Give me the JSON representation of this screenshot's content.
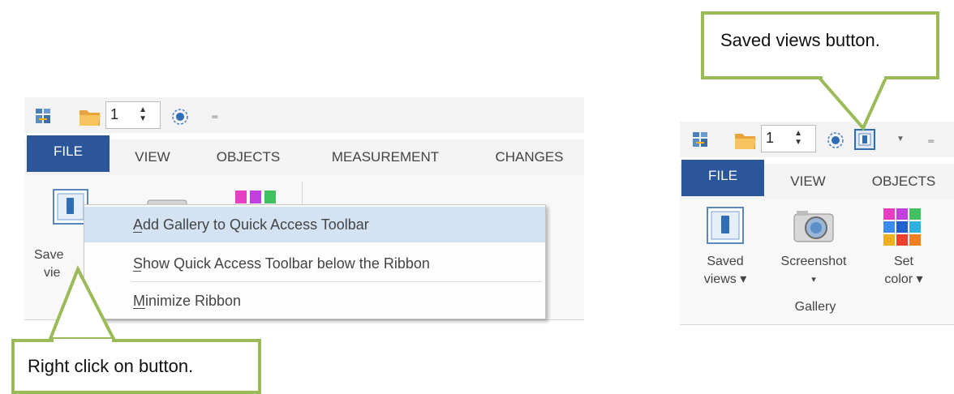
{
  "left_panel": {
    "qat": {
      "spin_value": "1",
      "customize": "₌"
    },
    "tabs": [
      "FILE",
      "VIEW",
      "OBJECTS",
      "MEASUREMENT",
      "CHANGES"
    ],
    "saved_views_partial": "Save",
    "views_partial": "vie"
  },
  "context_menu": {
    "items": [
      {
        "label": "Add Gallery to Quick Access Toolbar",
        "access_key": "A"
      },
      {
        "label": "Show Quick Access Toolbar below the Ribbon",
        "access_key": "S"
      },
      {
        "label": "Minimize Ribbon",
        "access_key": "M"
      }
    ]
  },
  "right_panel": {
    "qat": {
      "spin_value": "1",
      "customize": "₌"
    },
    "tabs": [
      "FILE",
      "VIEW",
      "OBJECTS"
    ],
    "buttons": [
      {
        "line1": "Saved",
        "line2": "views ▾"
      },
      {
        "line1": "Screenshot",
        "line2": "▾"
      },
      {
        "line1": "Set",
        "line2": "color ▾"
      }
    ],
    "group_label": "Gallery"
  },
  "callouts": {
    "left": "Right click on button.",
    "right": "Saved views button."
  },
  "colors": {
    "file_tab": "#2b579a",
    "callout_border": "#9bbb59",
    "menu_highlight": "#d4e3f3"
  }
}
